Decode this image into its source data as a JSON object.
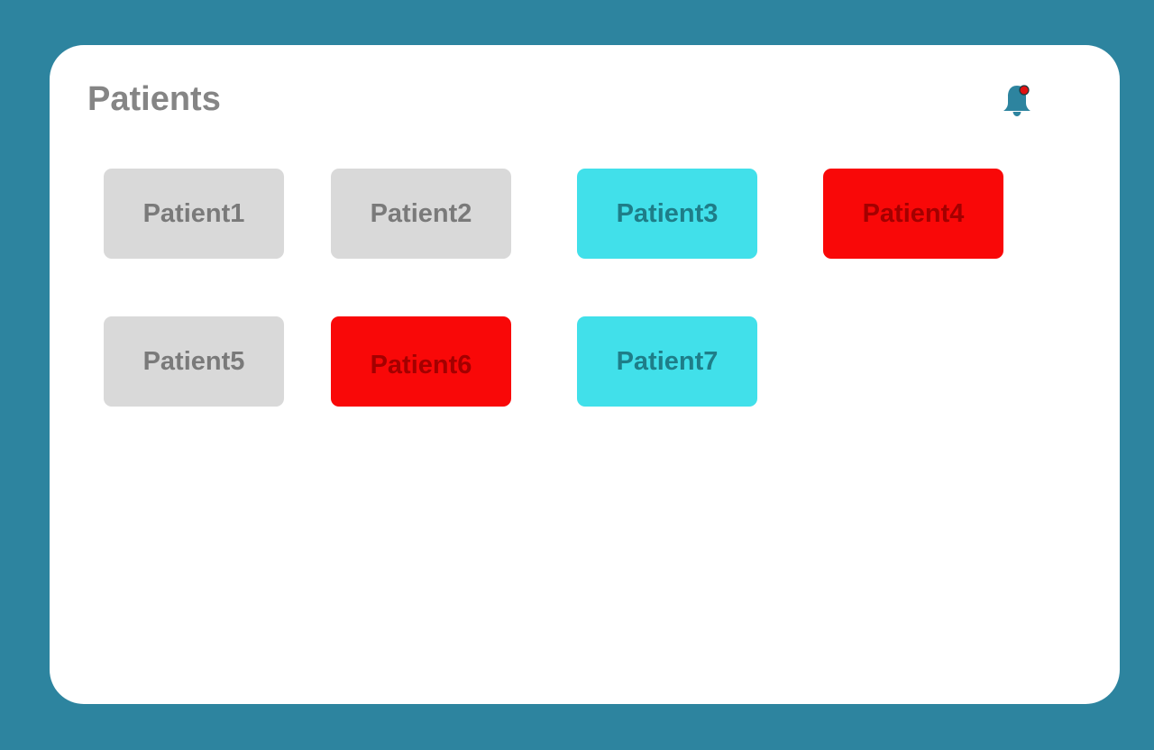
{
  "header": {
    "title": "Patients"
  },
  "notifications": {
    "icon": "bell-icon",
    "has_unread": true,
    "icon_color": "#2d849f",
    "badge_color": "#e01212"
  },
  "status_colors": {
    "gray": "#d9d9d9",
    "cyan": "#41e0ea",
    "red": "#f90808"
  },
  "patients": [
    {
      "label": "Patient1",
      "status": "gray"
    },
    {
      "label": "Patient2",
      "status": "gray"
    },
    {
      "label": "Patient3",
      "status": "cyan"
    },
    {
      "label": "Patient4",
      "status": "red"
    },
    {
      "label": "Patient5",
      "status": "gray"
    },
    {
      "label": "Patient6",
      "status": "red"
    },
    {
      "label": "Patient7",
      "status": "cyan"
    }
  ]
}
